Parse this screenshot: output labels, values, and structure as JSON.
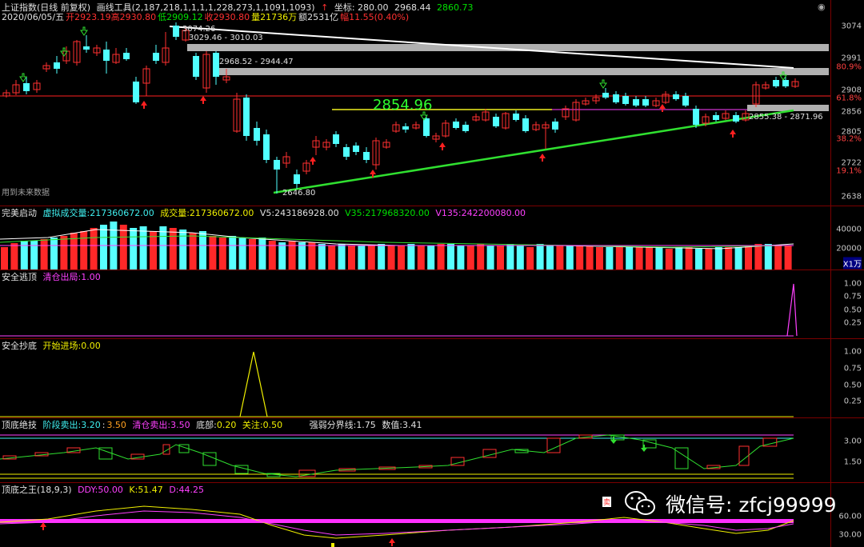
{
  "header": {
    "title": "上证指数(日线 前复权)",
    "date": "2020/06/05/五",
    "tool": "画线工具(2,187,218,1,1,1,1,228,273,1,1091,1093)",
    "coord": "坐标: 280.00",
    "open_label": "开",
    "open": "2923.19",
    "high_label": "高",
    "high": "2930.80",
    "low_label": "低",
    "low": "2909.12",
    "close_label": "收",
    "close": "2930.80",
    "vol_label": "量",
    "vol": "21736万",
    "amt_label": "额",
    "amt": "2531亿",
    "chg_label": "幅",
    "chg": "11.55(0.40%)",
    "p1": "2968.44",
    "p2": "2860.73"
  },
  "main": {
    "price_ticks": [
      "3074",
      "2991",
      "80.9%",
      "2908",
      "61.8%",
      "2856",
      "2805",
      "38.2%",
      "2722",
      "19.1%",
      "2638"
    ],
    "annotations": {
      "a1": "3074.26",
      "a2": "3029.46 - 3010.03",
      "a3": "2968.52 - 2944.47",
      "a4": "2854.96",
      "a5": "2855.38 - 2871.96",
      "a6": "2646.80",
      "future": "用到未来数据"
    }
  },
  "volume": {
    "name": "完美启动",
    "l1": "虚拟成交量:",
    "v1": "217360672.00",
    "l2": "成交量:",
    "v2": "217360672.00",
    "l3": "V5:",
    "v3": "243186928.00",
    "l4": "V35:",
    "v4": "217968320.00",
    "l5": "V135:",
    "v5": "242200080.00",
    "ticks": [
      "40000",
      "20000"
    ],
    "unit": "X1万"
  },
  "escape": {
    "name": "安全逃顶",
    "label": "清仓出局:",
    "value": "1.00",
    "ticks": [
      "1.00",
      "0.75",
      "0.50",
      "0.25"
    ]
  },
  "bottom": {
    "name": "安全抄底",
    "label": "开始进场:",
    "value": "0.00",
    "ticks": [
      "1.00",
      "0.75",
      "0.50",
      "0.25"
    ]
  },
  "topbottom": {
    "name": "顶底绝技",
    "l1": "阶段卖出:",
    "v1": "3.20",
    "v1b": "3.50",
    "l2": "清仓卖出:",
    "v2": "3.50",
    "l3": "底部:",
    "v3": "0.20",
    "l4": "关注:",
    "v4": "0.50",
    "l5": "强弱分界线:",
    "v5": "1.75",
    "l6": "数值:",
    "v6": "3.41",
    "ticks": [
      "3.00",
      "1.50"
    ]
  },
  "king": {
    "name": "顶底之王(18,9,3)",
    "l1": "DDY:",
    "v1": "50.00",
    "l2": "K:",
    "v2": "51.47",
    "l3": "D:",
    "v3": "44.25",
    "ticks": [
      "60.00",
      "30.00"
    ],
    "mark": "卖"
  },
  "watermark": "微信号: zfcj99999",
  "colors": {
    "up": "#ff3030",
    "down": "#50ffff",
    "bg": "#000000",
    "grid": "#7a0000"
  }
}
